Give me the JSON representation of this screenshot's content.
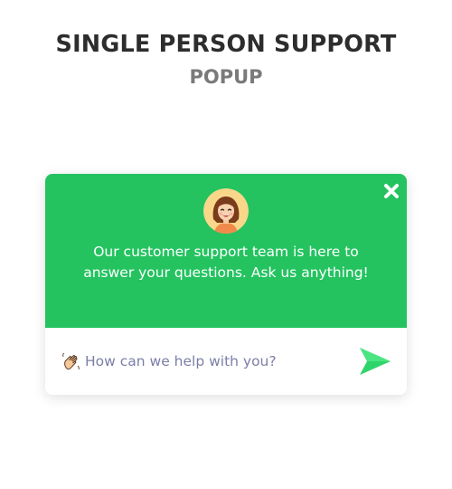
{
  "header": {
    "title": "SINGLE PERSON SUPPORT",
    "subtitle": "POPUP"
  },
  "popup": {
    "message": "Our customer support team is here to answer your questions. Ask us anything!",
    "close_icon": "close-icon",
    "avatar_icon": "support-agent-avatar",
    "input": {
      "placeholder": "How can we help with you?",
      "value": "",
      "leading_icon": "waving-hand-icon"
    },
    "send_icon": "send-icon"
  },
  "colors": {
    "accent": "#24c360",
    "title": "#2d2d2d",
    "subtitle": "#7a7a7a",
    "placeholder": "#7b7fa6",
    "send": "#2fd46a"
  }
}
